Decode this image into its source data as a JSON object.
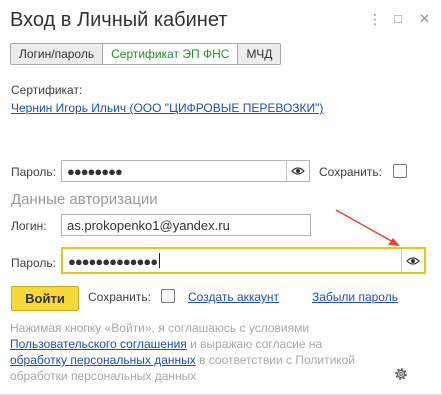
{
  "window": {
    "title": "Вход в Личный кабинет",
    "more_icon": "⋮",
    "restore_icon": "□",
    "close_icon": "✕"
  },
  "tabs": [
    {
      "label": "Логин/пароль",
      "active": false
    },
    {
      "label": "Сертификат ЭП ФНС",
      "active": true
    },
    {
      "label": "МЧД",
      "active": false
    }
  ],
  "certificate": {
    "label": "Сертификат:",
    "value": "Чернин Игорь Ильич (ООО \"ЦИФРОВЫЕ ПЕРЕВОЗКИ\")"
  },
  "cert_password": {
    "label": "Пароль:",
    "value": "●●●●●●●●",
    "save_label": "Сохранить:"
  },
  "auth": {
    "section_title": "Данные авторизации",
    "login_label": "Логин:",
    "login_value": "as.prokopenko1@yandex.ru",
    "password_label": "Пароль:",
    "password_value": "●●●●●●●●●●●●●"
  },
  "actions": {
    "login_button": "Войти",
    "save_label": "Сохранить:",
    "create_account": "Создать аккаунт",
    "forgot_password": "Забыли пароль"
  },
  "agreement": {
    "text1": "Нажимая кнопку «Войти», я соглашаюсь с условиями",
    "link1": "Пользовательского соглашения",
    "text2": " и выражаю согласие на",
    "link2": "обработку персональных данных",
    "text3": " в соответствии с Политикой",
    "text4": "обработки персональных данных"
  },
  "colors": {
    "accent_yellow": "#f6d83b",
    "focus_border": "#e9c21f",
    "link_blue": "#1f4fb0",
    "active_tab_green": "#2a8a2f",
    "annotation_arrow": "#e0472f"
  }
}
